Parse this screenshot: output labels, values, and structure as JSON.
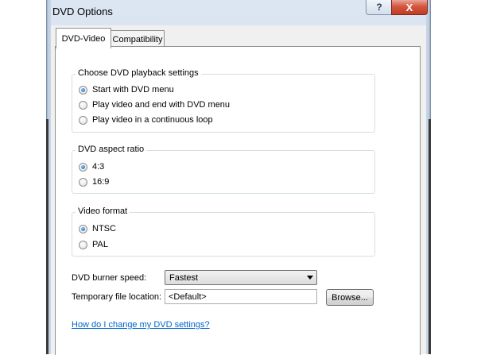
{
  "window": {
    "title": "DVD Options",
    "help_glyph": "?",
    "close_glyph": "X"
  },
  "tabs": [
    {
      "label": "DVD-Video",
      "active": true
    },
    {
      "label": "Compatibility",
      "active": false
    }
  ],
  "playback": {
    "legend": "Choose DVD playback settings",
    "options": [
      {
        "label": "Start with DVD menu",
        "checked": true
      },
      {
        "label": "Play video and end with DVD menu",
        "checked": false
      },
      {
        "label": "Play video in a continuous loop",
        "checked": false
      }
    ]
  },
  "aspect": {
    "legend": "DVD aspect ratio",
    "options": [
      {
        "label": "4:3",
        "checked": true
      },
      {
        "label": "16:9",
        "checked": false
      }
    ]
  },
  "format": {
    "legend": "Video format",
    "options": [
      {
        "label": "NTSC",
        "checked": true
      },
      {
        "label": "PAL",
        "checked": false
      }
    ]
  },
  "burner": {
    "label": "DVD burner speed:",
    "value": "Fastest"
  },
  "temp": {
    "label": "Temporary file location:",
    "value": "<Default>",
    "browse_label": "Browse..."
  },
  "help_link": "How do I change my DVD settings?"
}
